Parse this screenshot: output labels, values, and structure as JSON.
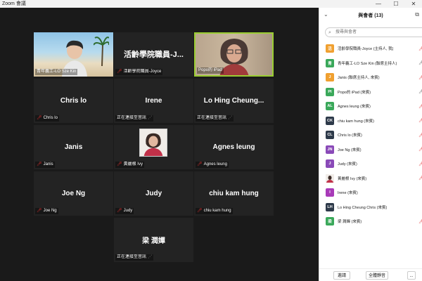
{
  "window": {
    "title": "Zoom 會議",
    "min": "—",
    "max": "☐",
    "close": "✕"
  },
  "colors": {
    "tile_bg": "#232323",
    "active_border": "#9acd32",
    "mute": "#e03030"
  },
  "tiles": [
    {
      "name": "",
      "label": "青年義工-LO Sze Kin",
      "muted": false
    },
    {
      "name": "活齡學院職員-J...",
      "label": "活齡學院職員-Joyce",
      "muted": true
    },
    {
      "name": "",
      "label": "Popo的 iPad",
      "muted": false
    },
    {
      "name": "Chris lo",
      "label": "Chris lo",
      "muted": true
    },
    {
      "name": "Irene",
      "label": "正在連接至音訊",
      "muted": false
    },
    {
      "name": "Lo Hing Cheung...",
      "label": "正在連接至音訊",
      "muted": false
    },
    {
      "name": "Janis",
      "label": "Janis",
      "muted": true
    },
    {
      "name": "",
      "label": "黃麗根 Ivy",
      "muted": true
    },
    {
      "name": "Agnes leung",
      "label": "Agnes leung",
      "muted": true
    },
    {
      "name": "Joe Ng",
      "label": "Joe Ng",
      "muted": true
    },
    {
      "name": "Judy",
      "label": "Judy",
      "muted": true
    },
    {
      "name": "chiu kam hung",
      "label": "chiu kam hung",
      "muted": true
    },
    {
      "name": "梁 潤嬋",
      "label": "正在連接至音訊",
      "muted": false
    }
  ],
  "panel": {
    "title": "與會者 (13)",
    "search_placeholder": "搜尋與會者",
    "participants": [
      {
        "initials": "活",
        "color": "#f0a030",
        "name": "活齡學院職員-Joyce (主持人, 我)",
        "status": "muted"
      },
      {
        "initials": "青",
        "color": "#3aa85a",
        "name": "青年義工-LO Sze Kin (聯席主持人)",
        "status": "on"
      },
      {
        "initials": "J",
        "color": "#f0a030",
        "name": "Janis (聯席主持人, 來賓)",
        "status": "muted"
      },
      {
        "initials": "PI",
        "color": "#3aa85a",
        "name": "Popo的 iPad (來賓)",
        "status": "on"
      },
      {
        "initials": "AL",
        "color": "#3aa85a",
        "name": "Agnes leung (來賓)",
        "status": "muted"
      },
      {
        "initials": "CK",
        "color": "#2e3a4a",
        "name": "chiu kam hung (來賓)",
        "status": "muted"
      },
      {
        "initials": "CL",
        "color": "#2e3a4a",
        "name": "Chris lo (來賓)",
        "status": "muted"
      },
      {
        "initials": "JN",
        "color": "#8a4ab8",
        "name": "Joe Ng (來賓)",
        "status": "muted"
      },
      {
        "initials": "J",
        "color": "#8a4ab8",
        "name": "Judy (來賓)",
        "status": "muted"
      },
      {
        "initials": "",
        "color": "#c8a890",
        "name": "黃麗根 Ivy (來賓)",
        "status": "muted"
      },
      {
        "initials": "I",
        "color": "#a83ab8",
        "name": "Irene (來賓)",
        "status": "none"
      },
      {
        "initials": "LH",
        "color": "#2e3a4a",
        "name": "Lo Hing Cheung Chris (來賓)",
        "status": "none"
      },
      {
        "initials": "梁",
        "color": "#3aa85a",
        "name": "梁 潤嬋 (來賓)",
        "status": "muted"
      }
    ],
    "footer": {
      "invite": "邀請",
      "mute_all": "全體靜音",
      "more": "..."
    }
  }
}
